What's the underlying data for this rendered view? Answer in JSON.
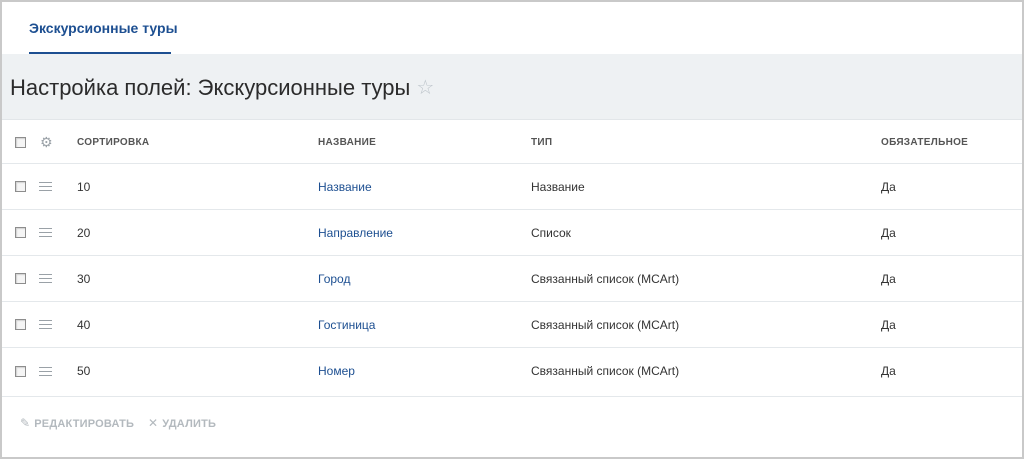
{
  "tabs": [
    {
      "label": "Экскурсионные туры"
    }
  ],
  "header": {
    "title": "Настройка полей: Экскурсионные туры"
  },
  "table": {
    "columns": {
      "sort": "СОРТИРОВКА",
      "name": "НАЗВАНИЕ",
      "type": "ТИП",
      "required": "ОБЯЗАТЕЛЬНОЕ"
    },
    "rows": [
      {
        "sort": "10",
        "name": "Название",
        "type": "Название",
        "required": "Да"
      },
      {
        "sort": "20",
        "name": "Направление",
        "type": "Список",
        "required": "Да"
      },
      {
        "sort": "30",
        "name": "Город",
        "type": "Связанный список (MCArt)",
        "required": "Да"
      },
      {
        "sort": "40",
        "name": "Гостиница",
        "type": "Связанный список (MCArt)",
        "required": "Да"
      },
      {
        "sort": "50",
        "name": "Номер",
        "type": "Связанный список (MCArt)",
        "required": "Да"
      }
    ]
  },
  "footer": {
    "edit_label": "РЕДАКТИРОВАТЬ",
    "delete_label": "УДАЛИТЬ"
  },
  "icons": {
    "star": "star-icon",
    "gear": "gear-icon",
    "handle": "drag-handle-icon",
    "edit": "pencil-icon",
    "delete": "close-icon"
  },
  "colors": {
    "accent": "#1d4f91",
    "header_bg": "#eef1f3",
    "disabled": "#b3b9be"
  }
}
